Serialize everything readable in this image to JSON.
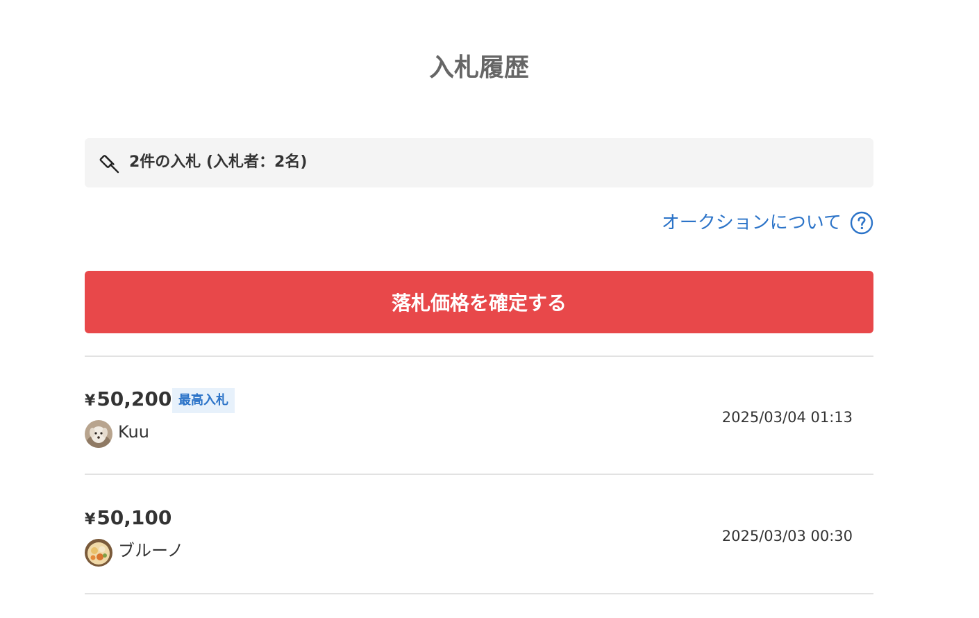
{
  "page": {
    "title": "入札履歴"
  },
  "summary": {
    "icon": "gavel-icon",
    "text": "2件の入札 (入札者：2名)"
  },
  "about_link": {
    "label": "オークションについて",
    "icon": "question-circle-icon",
    "color": "#2b73c8"
  },
  "confirm_button": {
    "label": "落札価格を確定する",
    "color": "#e8484a"
  },
  "bids": [
    {
      "currency_symbol": "¥",
      "amount": "50,200",
      "badge": "最高入札",
      "bidder": "Kuu",
      "avatar": "dog-photo-avatar",
      "timestamp": "2025/03/04 01:13"
    },
    {
      "currency_symbol": "¥",
      "amount": "50,100",
      "badge": "",
      "bidder": "ブルーノ",
      "avatar": "food-photo-avatar",
      "timestamp": "2025/03/03 00:30"
    }
  ]
}
